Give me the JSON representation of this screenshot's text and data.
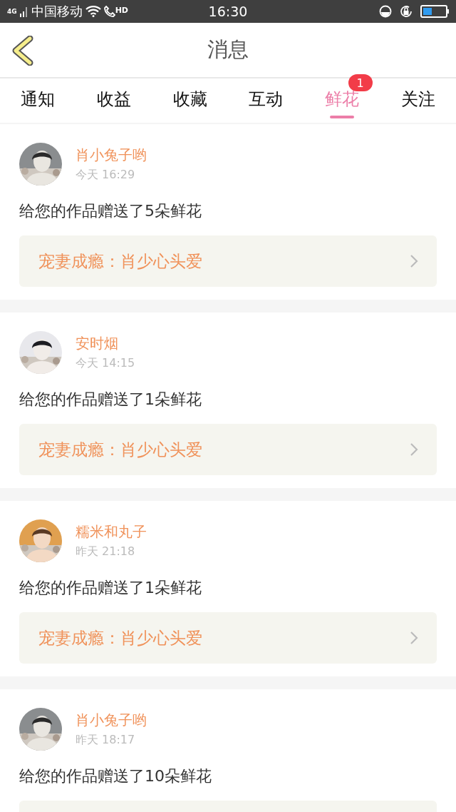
{
  "status_bar": {
    "network": "4G",
    "carrier": "中国移动",
    "call_tag": "HD",
    "time": "16:30"
  },
  "header": {
    "title": "消息"
  },
  "tabs": [
    {
      "label": "通知",
      "selected": false
    },
    {
      "label": "收益",
      "selected": false
    },
    {
      "label": "收藏",
      "selected": false
    },
    {
      "label": "互动",
      "selected": false
    },
    {
      "label": "鲜花",
      "selected": true,
      "badge": "1"
    },
    {
      "label": "关注",
      "selected": false
    }
  ],
  "messages": [
    {
      "name": "肖小兔子哟",
      "time": "今天 16:29",
      "text": "给您的作品赠送了5朵鲜花",
      "book": "宠妻成瘾：肖少心头爱"
    },
    {
      "name": "安时烟",
      "time": "今天 14:15",
      "text": "给您的作品赠送了1朵鲜花",
      "book": "宠妻成瘾：肖少心头爱"
    },
    {
      "name": "糯米和丸子",
      "time": "昨天 21:18",
      "text": "给您的作品赠送了1朵鲜花",
      "book": "宠妻成瘾：肖少心头爱"
    },
    {
      "name": "肖小兔子哟",
      "time": "昨天 18:17",
      "text": "给您的作品赠送了10朵鲜花"
    }
  ]
}
